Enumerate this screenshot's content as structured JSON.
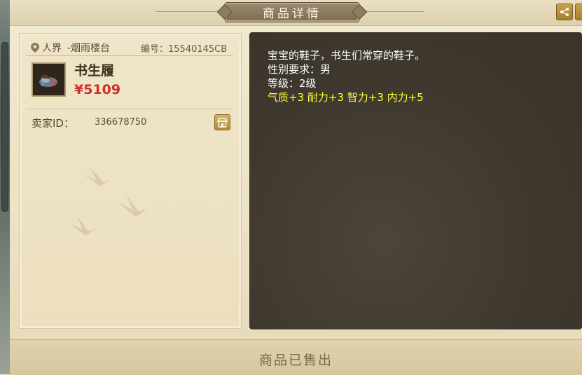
{
  "header": {
    "title": "商品详情"
  },
  "item": {
    "realm": "人界",
    "server": "-烟雨楼台",
    "number_label": "编号：",
    "number": "15540145CB",
    "name": "书生履",
    "price": "¥5109",
    "icon": "shoe-item-icon"
  },
  "seller": {
    "label": "卖家ID：",
    "id": "336678750"
  },
  "description": {
    "line1": "宝宝的鞋子，书生们常穿的鞋子。",
    "line2": "性别要求：男",
    "line3": "等级：2级",
    "attrs": "气质+3 耐力+3 智力+3 内力+5"
  },
  "footer": {
    "status": "商品已售出"
  },
  "colors": {
    "price": "#cf2f2a",
    "attrs": "#ffff3b",
    "panel_dark": "#3e382e",
    "accent_gold": "#b48c36"
  }
}
